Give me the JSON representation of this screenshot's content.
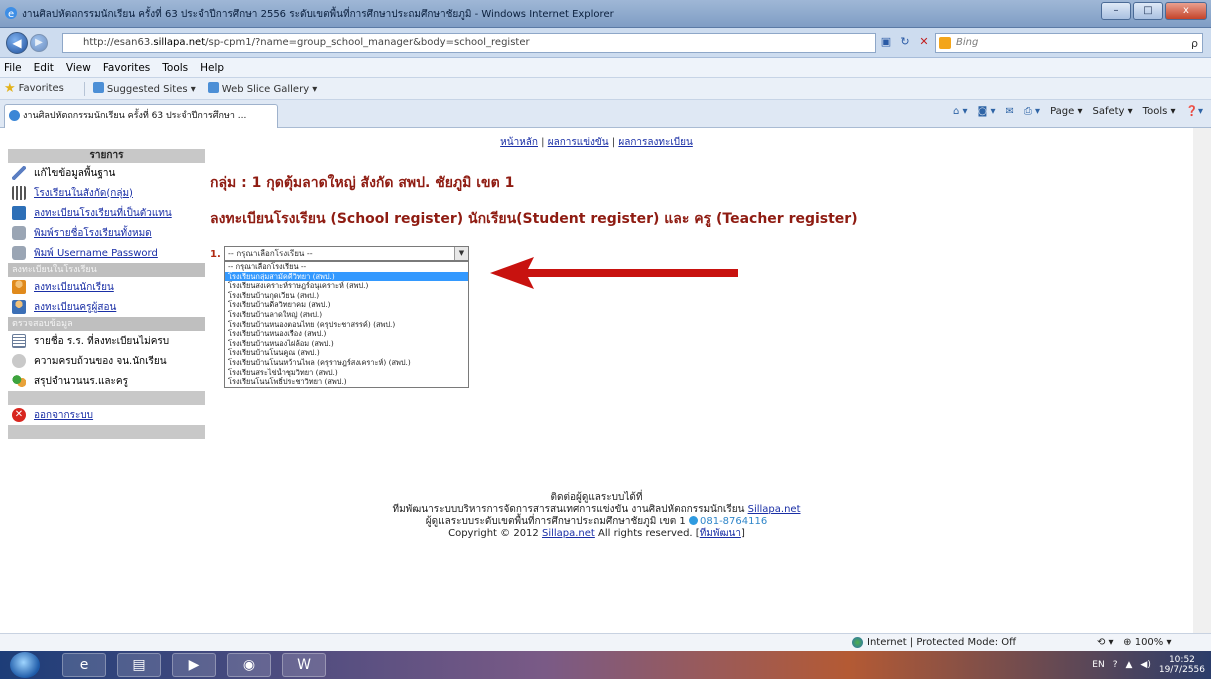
{
  "window": {
    "title": "งานศิลปหัตถกรรมนักเรียน ครั้งที่ 63 ประจำปีการศึกษา 2556 ระดับเขตพื้นที่การศึกษาประถมศึกษาชัยภูมิ - Windows Internet Explorer",
    "minimize": "–",
    "maximize": "□",
    "close": "x"
  },
  "address": {
    "url_prefix": "http://esan63.",
    "url_domain": "sillapa.net",
    "url_path": "/sp-cpm1/?name=group_school_manager&body=school_register",
    "search_placeholder": "Bing",
    "search_go": "ρ"
  },
  "menu": [
    "File",
    "Edit",
    "View",
    "Favorites",
    "Tools",
    "Help"
  ],
  "favorites": {
    "label": "Favorites",
    "items": [
      "Suggested Sites ▾",
      "Web Slice Gallery ▾"
    ]
  },
  "tab": {
    "title": "งานศิลปหัตถกรรมนักเรียน ครั้งที่ 63 ประจำปีการศึกษา ..."
  },
  "command_bar": [
    "Page ▾",
    "Safety ▾",
    "Tools ▾"
  ],
  "page": {
    "topnav": [
      "หน้าหลัก",
      "ผลการแข่งขัน",
      "ผลการลงทะเบียน"
    ],
    "topnav_sep": "|",
    "sidebar": {
      "header": "รายการ",
      "items1": [
        {
          "label": "แก้ไขข้อมูลพื้นฐาน",
          "link": false
        },
        {
          "label": "โรงเรียนในสังกัด(กลุ่ม)",
          "link": true
        },
        {
          "label": "ลงทะเบียนโรงเรียนที่เป็นตัวแทน",
          "link": true
        },
        {
          "label": "พิมพ์รายชื่อโรงเรียนทั้งหมด",
          "link": true
        },
        {
          "label": "พิมพ์ Username Password",
          "link": true
        }
      ],
      "section2": "ลงทะเบียนในโรงเรียน",
      "items2": [
        {
          "label": "ลงทะเบียนนักเรียน",
          "link": true
        },
        {
          "label": "ลงทะเบียนครูผู้สอน",
          "link": true
        }
      ],
      "section3": "ตรวจสอบข้อมูล",
      "items3": [
        {
          "label": "รายชื่อ ร.ร. ที่ลงทะเบียนไม่ครบ",
          "link": false
        },
        {
          "label": "ความครบถ้วนของ จน.นักเรียน",
          "link": false
        },
        {
          "label": "สรุปจำนวนนร.และครู",
          "link": false
        }
      ],
      "logout": "ออกจากระบบ"
    },
    "group_title": "กลุ่ม : 1 กุดตุ้มลาดใหญ่ สังกัด สพป. ชัยภูมิ เขต 1",
    "register_title": "ลงทะเบียนโรงเรียน (School register) นักเรียน(Student register) และ ครู (Teacher register)",
    "select_number": "1.",
    "select_value": "-- กรุณาเลือกโรงเรียน --",
    "select_arrow": "▼",
    "options": [
      "-- กรุณาเลือกโรงเรียน --",
      "โรงเรียนกลุ่มสามัคคีวิทยา (สพป.)",
      "โรงเรียนสงเคราะห์ราษฎร์อนุเคราะห์ (สพป.)",
      "โรงเรียนบ้านกุดเวียน (สพป.)",
      "โรงเรียนบ้านดีลวิทยาคม (สพป.)",
      "โรงเรียนบ้านลาดใหญ่ (สพป.)",
      "โรงเรียนบ้านหนองตอนไทย (ครุประชาสรรค์) (สพป.)",
      "โรงเรียนบ้านหนองเรือง (สพป.)",
      "โรงเรียนบ้านหนองไผ่ล้อม (สพป.)",
      "โรงเรียนบ้านโนนคูณ (สพป.)",
      "โรงเรียนบ้านโนนหว้านไพล (ครุราษฎร์สงเคราะห์) (สพป.)",
      "โรงเรียนสระไข่น้ำชุมวิทยา (สพป.)",
      "โรงเรียนโนนโพธิ์ประชาวิทยา (สพป.)"
    ],
    "selected_option_index": 1,
    "footer": {
      "line1": "ติดต่อผู้ดูแลระบบได้ที่",
      "line2_prefix": "ทีมพัฒนาระบบบริหารการจัดการสารสนเทศการแข่งขัน งานศิลปหัตถกรรมนักเรียน ",
      "line2_link": "Sillapa.net",
      "line3_prefix": "ผู้ดูแลระบบระดับเขตพื้นที่การศึกษาประถมศึกษาชัยภูมิ เขต 1 ",
      "line3_phone": "081-8764116",
      "line4_prefix": "Copyright © 2012 ",
      "line4_link": "Sillapa.net",
      "line4_middle": " All rights reserved. [",
      "line4_team": "ทีมพัฒนา",
      "line4_end": "]"
    }
  },
  "status": {
    "zone": "Internet | Protected Mode: Off",
    "zoom": "100%"
  },
  "taskbar": {
    "lang": "EN",
    "time": "10:52",
    "date": "19/7/2556"
  }
}
